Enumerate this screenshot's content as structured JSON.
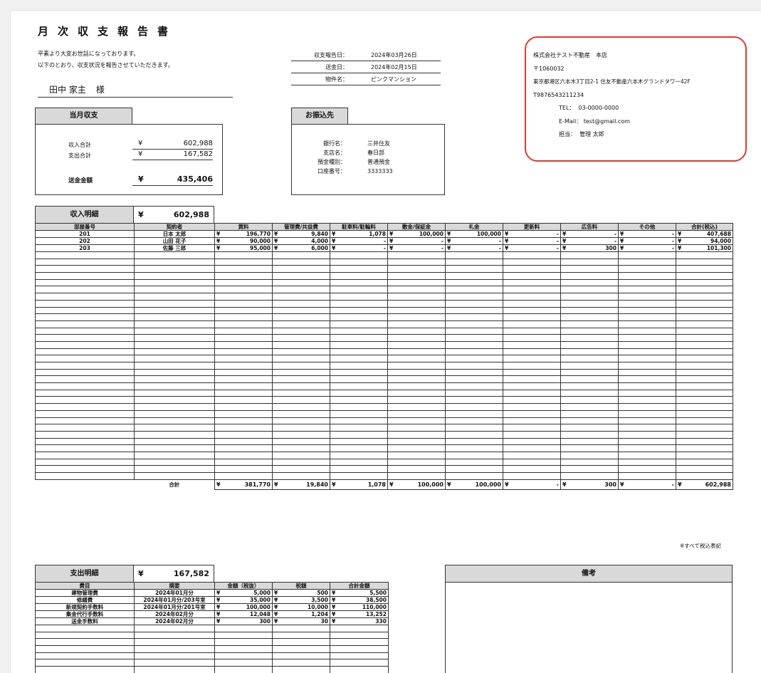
{
  "doc": {
    "title": "月次収支報告書",
    "intro": [
      "平素より大変お世話になっております。",
      "以下のとおり、収支状況を報告させていただきます。"
    ],
    "owner_name": "田中 家主",
    "owner_suffix": "様"
  },
  "meta": [
    {
      "label": "収支報告日：",
      "value": "2024年03月26日"
    },
    {
      "label": "送金日：",
      "value": "2024年02月15日"
    },
    {
      "label": "物件名：",
      "value": "ピンクマンション"
    }
  ],
  "company": {
    "name": "株式会社テスト不動産　本店",
    "postal": "〒1060032",
    "address": "東京都港区六本木3丁目2-1 住友不動産六本木グランドタワー42F",
    "reg": "T9876543211234",
    "tel_label": "TEL：",
    "tel": "03-0000-0000",
    "mail_label": "E-Mail：",
    "mail": "test@gmail.com",
    "staff_label": "担当：",
    "staff": "管理 太郎"
  },
  "summary": {
    "header": "当月収支",
    "rows": [
      {
        "label": "収入合計",
        "yen": "¥",
        "value": "602,988"
      },
      {
        "label": "支出合計",
        "yen": "¥",
        "value": "167,582"
      }
    ],
    "total_label": "送金金額",
    "total_yen": "¥",
    "total_value": "435,406"
  },
  "bank": {
    "header": "お振込先",
    "rows": [
      {
        "label": "銀行名：",
        "value": "三井住友"
      },
      {
        "label": "支店名：",
        "value": "春日部"
      },
      {
        "label": "預金種別：",
        "value": "普通預金"
      },
      {
        "label": "口座番号：",
        "value": "3333333"
      }
    ]
  },
  "income": {
    "header": "収入明細",
    "total_yen": "¥",
    "total_value": "602,988",
    "columns": [
      "部屋番号",
      "契約者",
      "賃料",
      "管理費/共益費",
      "駐車料/駐輪料",
      "敷金/保証金",
      "礼金",
      "更新料",
      "広告料",
      "その他",
      "合計(税込)"
    ],
    "rows": [
      {
        "room": "201",
        "name": "日本 太郎",
        "vals": [
          "196,770",
          "9,840",
          "1,078",
          "100,000",
          "100,000",
          "-",
          "-",
          "-",
          "407,688"
        ]
      },
      {
        "room": "202",
        "name": "山田 花子",
        "vals": [
          "90,000",
          "4,000",
          "-",
          "-",
          "-",
          "-",
          "-",
          "-",
          "94,000"
        ]
      },
      {
        "room": "203",
        "name": "佐藤 三郎",
        "vals": [
          "95,000",
          "6,000",
          "-",
          "-",
          "-",
          "-",
          "300",
          "-",
          "101,300"
        ]
      }
    ],
    "total_label": "合計",
    "totals": [
      "381,770",
      "19,840",
      "1,078",
      "100,000",
      "100,000",
      "-",
      "300",
      "-",
      "602,988"
    ],
    "note": "※すべて税込表記",
    "yen": "¥"
  },
  "expense": {
    "header": "支出明細",
    "total_yen": "¥",
    "total_value": "167,582",
    "columns": [
      "費目",
      "摘要",
      "金額（税抜）",
      "税額",
      "合計金額"
    ],
    "rows": [
      {
        "item": "建物管理費",
        "desc": "2024年01月分",
        "vals": [
          "5,000",
          "500",
          "5,500"
        ]
      },
      {
        "item": "修繕費",
        "desc": "2024年01月分/203号室",
        "vals": [
          "35,000",
          "3,500",
          "38,500"
        ]
      },
      {
        "item": "新規契約手数料",
        "desc": "2024年01月分/201号室",
        "vals": [
          "100,000",
          "10,000",
          "110,000"
        ]
      },
      {
        "item": "集金代行手数料",
        "desc": "2024年02月分",
        "vals": [
          "12,048",
          "1,204",
          "13,252"
        ]
      },
      {
        "item": "送金手数料",
        "desc": "2024年02月分",
        "vals": [
          "300",
          "30",
          "330"
        ]
      }
    ]
  },
  "remarks": {
    "header": "備考"
  }
}
